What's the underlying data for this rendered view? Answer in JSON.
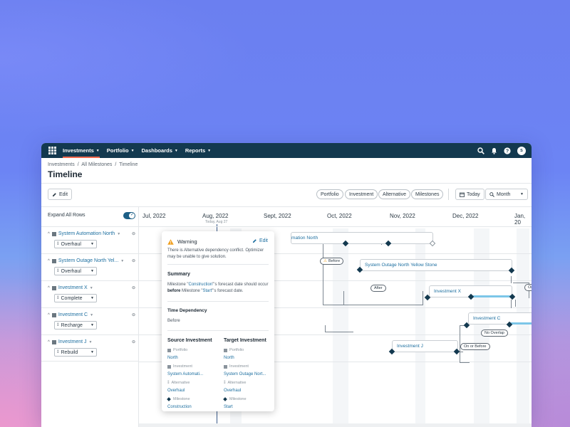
{
  "nav": {
    "items": [
      {
        "label": "Investments",
        "active": true
      },
      {
        "label": "Portfolio",
        "active": false
      },
      {
        "label": "Dashboards",
        "active": false
      },
      {
        "label": "Reports",
        "active": false
      }
    ],
    "avatar_initial": "S"
  },
  "breadcrumb": [
    "Investments",
    "/",
    "All Milestones",
    "/",
    "Timeline"
  ],
  "page_title": "Timeline",
  "toolbar": {
    "edit_label": "Edit",
    "chips": [
      "Portfolio",
      "Investment",
      "Alternative",
      "Milestones"
    ],
    "today_label": "Today",
    "scale_label": "Month"
  },
  "left_panel": {
    "expand_label": "Expand All Rows",
    "rows": [
      {
        "name": "System Automation North",
        "alternative": "Overhaul"
      },
      {
        "name": "System Outage North Yel...",
        "alternative": "Overhaul"
      },
      {
        "name": "Investment X",
        "alternative": "Complete"
      },
      {
        "name": "Investment C",
        "alternative": "Recharge"
      },
      {
        "name": "Investment J",
        "alternative": "Rebuild"
      }
    ]
  },
  "timeline": {
    "months": [
      "Jul, 2022",
      "Aug, 2022",
      "Sept, 2022",
      "Oct, 2022",
      "Nov, 2022",
      "Dec, 2022",
      "Jan, 20"
    ],
    "today_label": "Today, Aug 27",
    "bars": [
      {
        "label": "mation North"
      },
      {
        "label": "System Outage North Yellow Stone"
      },
      {
        "label": "Investment X"
      },
      {
        "label": "Investment C"
      },
      {
        "label": "Investment J"
      }
    ],
    "dependency_labels": {
      "before": "Before",
      "after": "After",
      "on": "On",
      "no_overlap": "No Overlap",
      "on_or_before": "On or Before"
    }
  },
  "popover": {
    "title": "Warning",
    "edit_label": "Edit",
    "message": "There is Alternative dependency conflict. Optimizer may be unable to give solution.",
    "summary_title": "Summary",
    "summary": {
      "pre": "Milestone \"",
      "m1": "Construction",
      "mid1": "\"'s forecast date should occur ",
      "before": "before",
      "mid2": " Milestone \"",
      "m2": "Start",
      "post": "\"'s forecast date."
    },
    "dependency_title": "Time Dependency",
    "dependency_value": "Before",
    "source": {
      "title": "Source Investment",
      "portfolio_label": "Portfolio",
      "portfolio": "North",
      "investment_label": "Investment",
      "investment": "System Automati...",
      "alternative_label": "Alternative",
      "alternative": "Overhaul",
      "milestone_label": "Milestone",
      "milestone": "Construction"
    },
    "target": {
      "title": "Target Investment",
      "portfolio_label": "Portfolio",
      "portfolio": "North",
      "investment_label": "Investment",
      "investment": "System Outage Nort...",
      "alternative_label": "Alternative",
      "alternative": "Overhaul",
      "milestone_label": "Milestone",
      "milestone": "Start"
    }
  },
  "colors": {
    "nav_bg": "#13394f",
    "accent": "#f26a4f",
    "link": "#1d6fa0",
    "warning": "#f0a020",
    "progress": "#7cc6e8"
  }
}
